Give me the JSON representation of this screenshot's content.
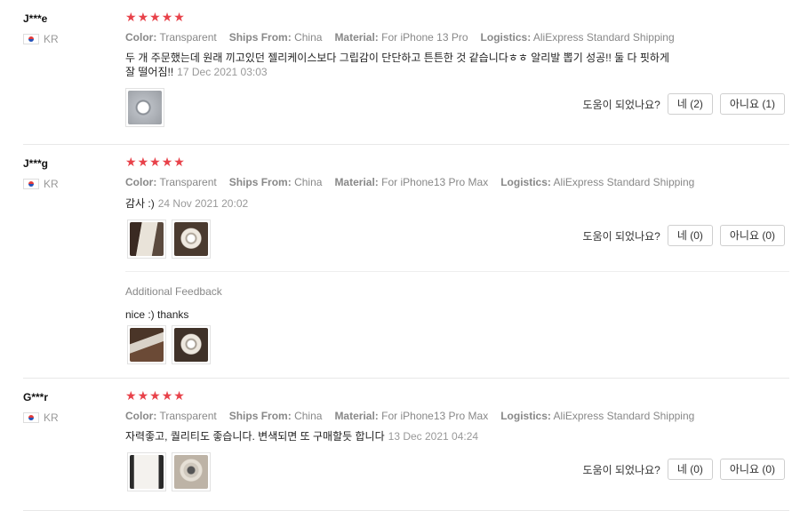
{
  "reviews": [
    {
      "user": "J***e",
      "country": "KR",
      "rating": 5,
      "attrs": [
        {
          "k": "Color:",
          "v": "Transparent"
        },
        {
          "k": "Ships From:",
          "v": "China"
        },
        {
          "k": "Material:",
          "v": "For iPhone 13 Pro"
        },
        {
          "k": "Logistics:",
          "v": "AliExpress Standard Shipping"
        }
      ],
      "text_line1": "두 개 주문했는데 원래 끼고있던 젤리케이스보다 그립감이 단단하고 튼튼한 것 같습니다ㅎㅎ 알리발 뽑기 성공!! 둘 다 핏하게",
      "text_line2": "잘 떨어짐!!",
      "date": "17 Dec 2021 03:03",
      "helpful_label": "도움이 되었나요?",
      "yes": "네 (2)",
      "no": "아니요 (1)"
    },
    {
      "user": "J***g",
      "country": "KR",
      "rating": 5,
      "attrs": [
        {
          "k": "Color:",
          "v": "Transparent"
        },
        {
          "k": "Ships From:",
          "v": "China"
        },
        {
          "k": "Material:",
          "v": "For iPhone13 Pro Max"
        },
        {
          "k": "Logistics:",
          "v": "AliExpress Standard Shipping"
        }
      ],
      "text": "감사 :)",
      "date": "24 Nov 2021 20:02",
      "helpful_label": "도움이 되었나요?",
      "yes": "네 (0)",
      "no": "아니요 (0)",
      "additional_title": "Additional Feedback",
      "additional_text": "nice :) thanks"
    },
    {
      "user": "G***r",
      "country": "KR",
      "rating": 5,
      "attrs": [
        {
          "k": "Color:",
          "v": "Transparent"
        },
        {
          "k": "Ships From:",
          "v": "China"
        },
        {
          "k": "Material:",
          "v": "For iPhone13 Pro Max"
        },
        {
          "k": "Logistics:",
          "v": "AliExpress Standard Shipping"
        }
      ],
      "text": "자력좋고, 퀄리티도 좋습니다. 변색되면 또 구매할듯 합니다",
      "date": "13 Dec 2021 04:24",
      "helpful_label": "도움이 되었나요?",
      "yes": "네 (0)",
      "no": "아니요 (0)"
    }
  ],
  "colors": {
    "star": "#e8424a",
    "meta": "#888888",
    "border": "#e8e8e8"
  }
}
